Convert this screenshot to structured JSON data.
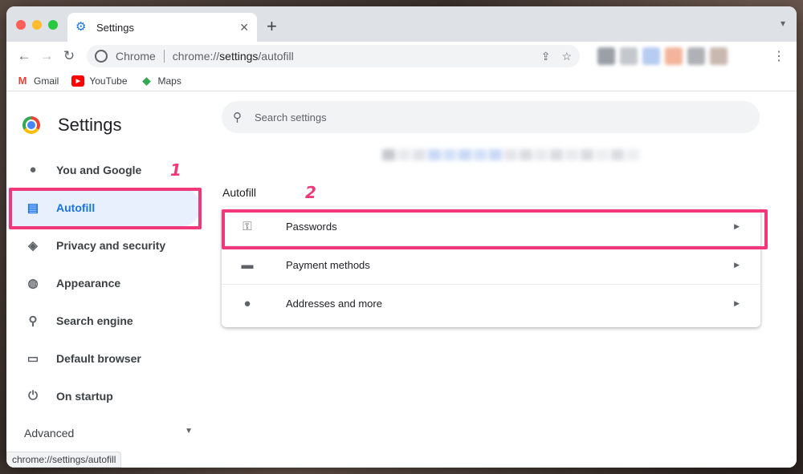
{
  "tab": {
    "title": "Settings",
    "close": "✕",
    "new": "+",
    "menu": "⌄"
  },
  "omnibox": {
    "site_label": "Chrome",
    "url_prefix": "chrome://",
    "url_bold": "settings",
    "url_suffix": "/autofill"
  },
  "bookmarks": [
    {
      "label": "Gmail"
    },
    {
      "label": "YouTube"
    },
    {
      "label": "Maps"
    }
  ],
  "sidebar": {
    "title": "Settings",
    "items": [
      {
        "label": "You and Google",
        "icon": "person-icon"
      },
      {
        "label": "Autofill",
        "icon": "clipboard-icon",
        "active": true
      },
      {
        "label": "Privacy and security",
        "icon": "shield-icon"
      },
      {
        "label": "Appearance",
        "icon": "palette-icon"
      },
      {
        "label": "Search engine",
        "icon": "search-icon"
      },
      {
        "label": "Default browser",
        "icon": "browser-icon"
      },
      {
        "label": "On startup",
        "icon": "power-icon"
      }
    ],
    "advanced": "Advanced"
  },
  "search": {
    "placeholder": "Search settings"
  },
  "main": {
    "section_title": "Autofill",
    "rows": [
      {
        "label": "Passwords",
        "icon": "key-icon"
      },
      {
        "label": "Payment methods",
        "icon": "credit-card-icon"
      },
      {
        "label": "Addresses and more",
        "icon": "location-pin-icon"
      }
    ]
  },
  "annotations": {
    "one": "1",
    "two": "2"
  },
  "status_url": "chrome://settings/autofill",
  "colors": {
    "accent": "#1a73e8",
    "highlight": "#f0387a",
    "active_bg": "#e8f0fe"
  }
}
